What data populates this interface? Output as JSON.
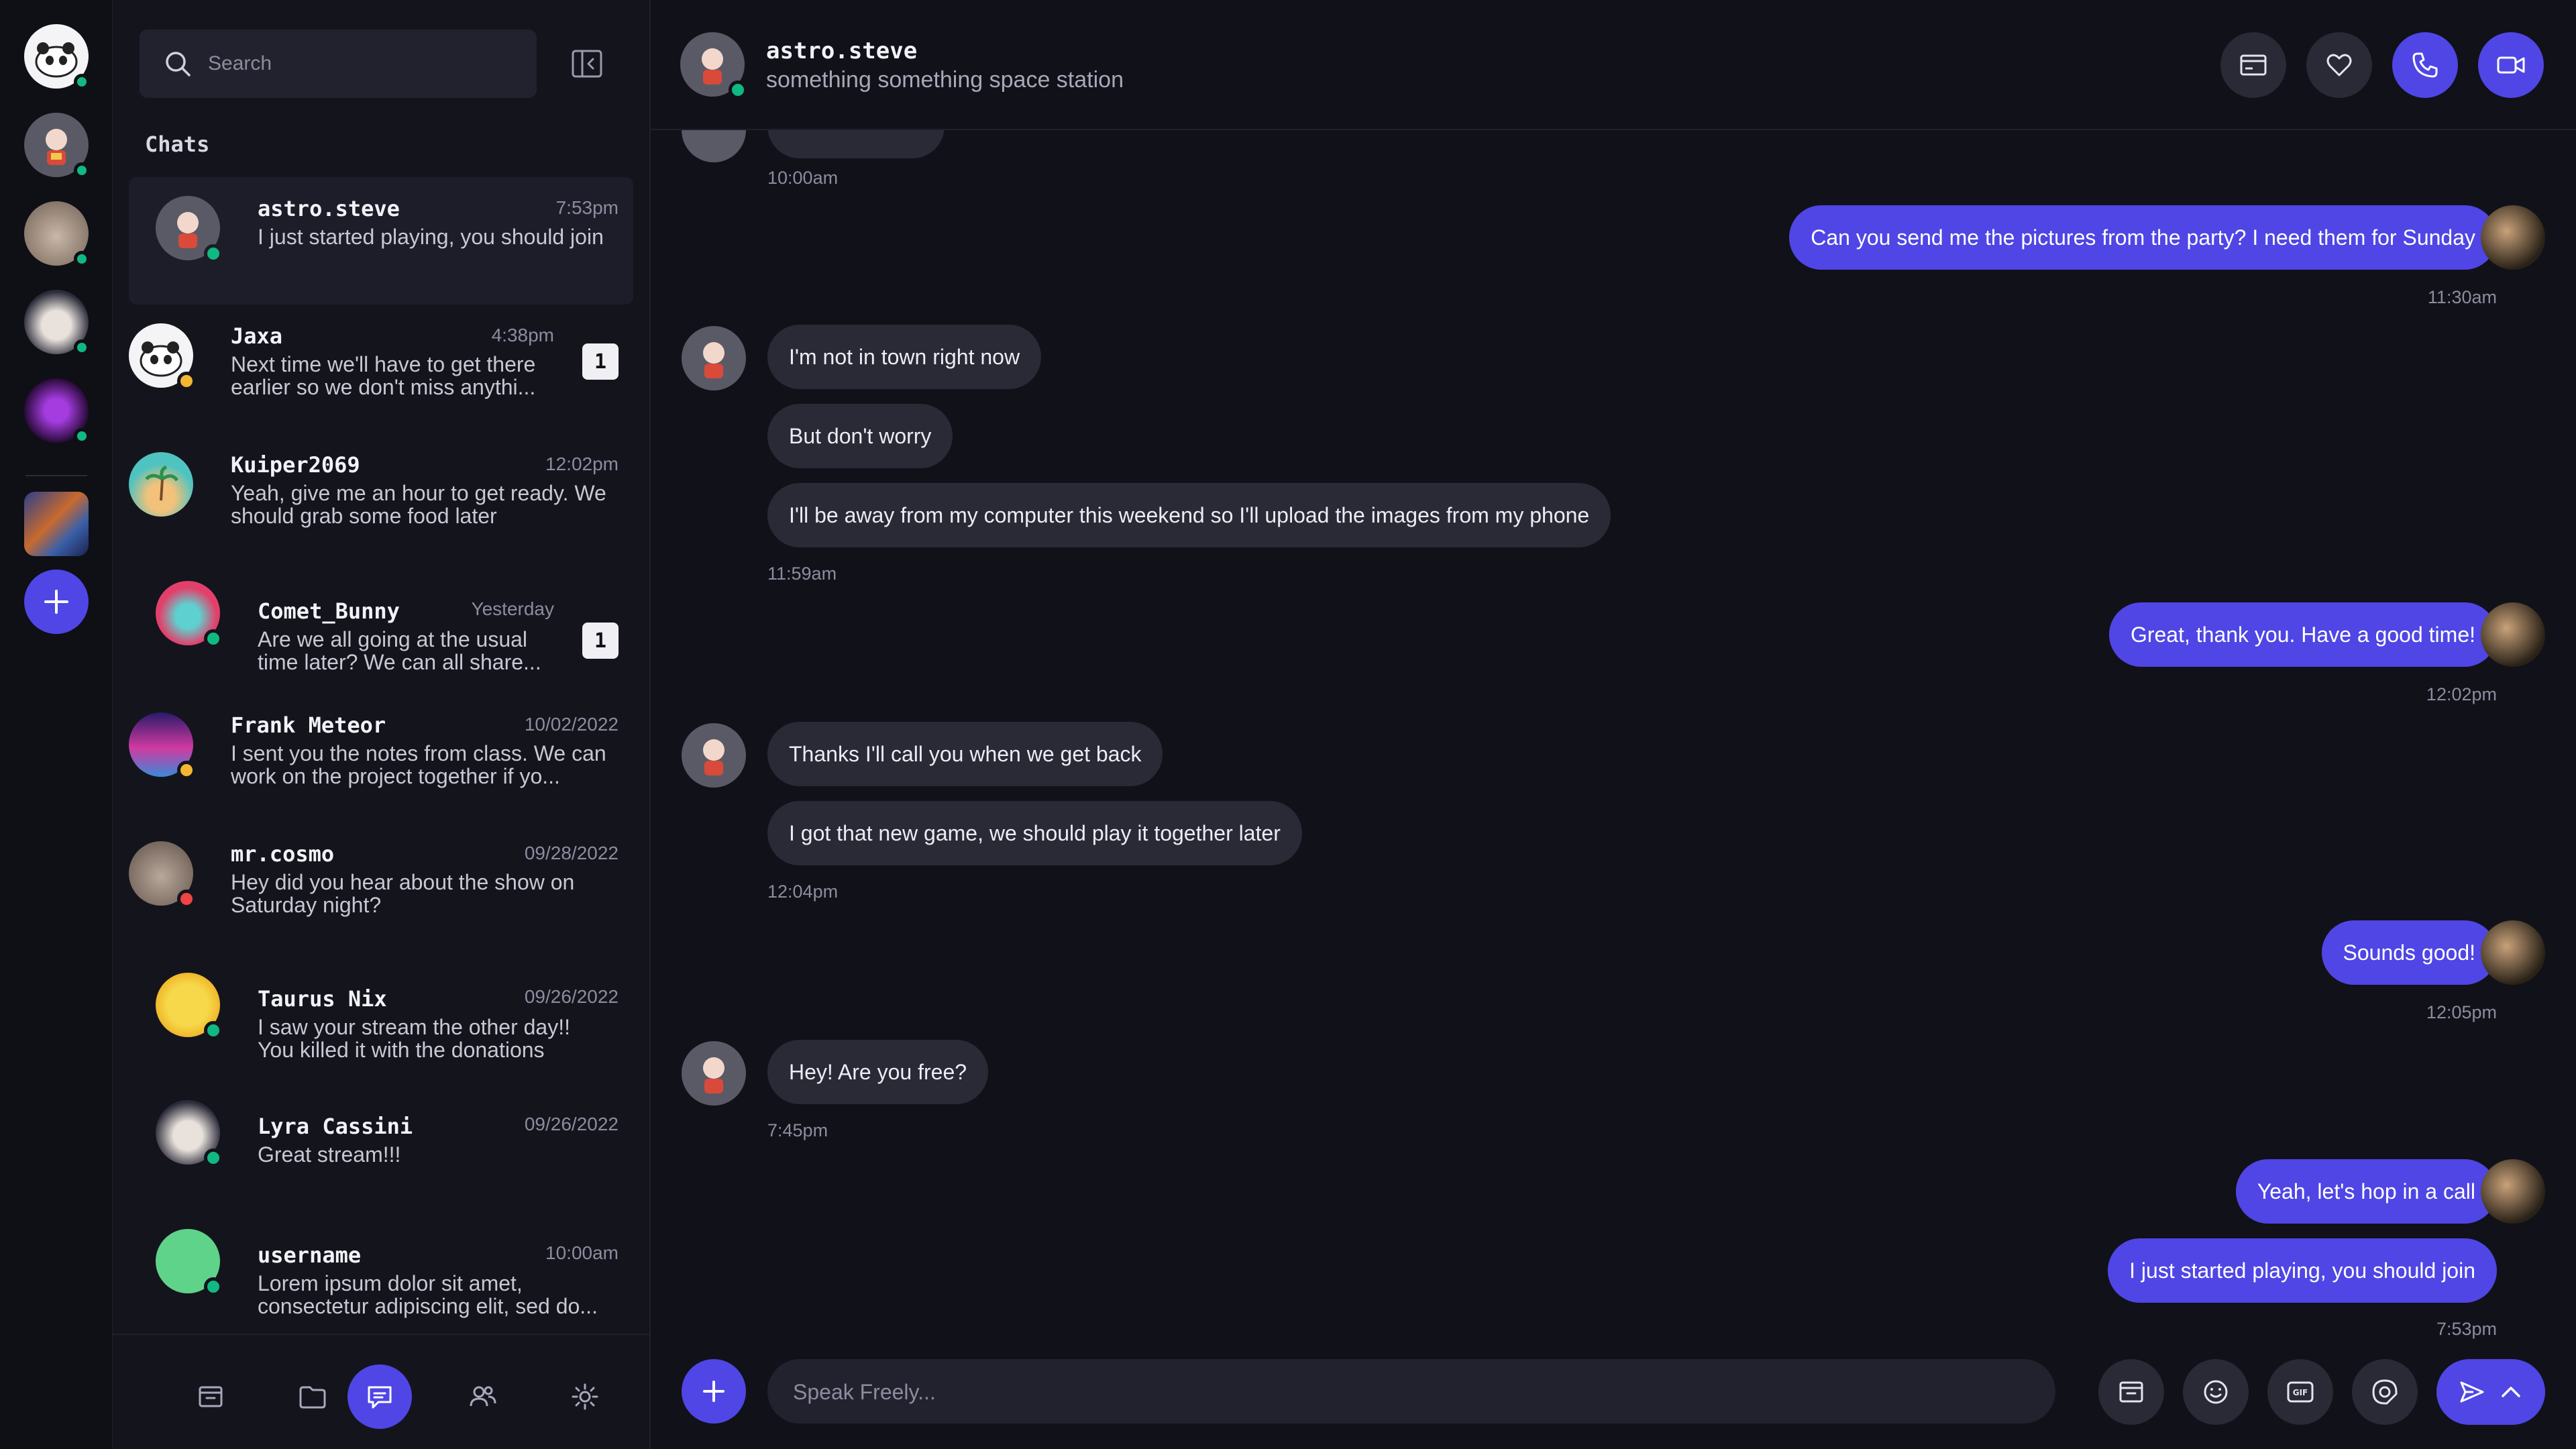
{
  "search": {
    "placeholder": "Search"
  },
  "sidebar": {
    "heading": "Chats",
    "chats": [
      {
        "name": "astro.steve",
        "time": "7:53pm",
        "preview": "I just started playing, you should join",
        "badge": "",
        "status": "online"
      },
      {
        "name": "Jaxa",
        "time": "4:38pm",
        "preview": "Next time we'll have to get there earlier so we don't miss anythi...",
        "badge": "1",
        "status": "away"
      },
      {
        "name": "Kuiper2069",
        "time": "12:02pm",
        "preview": "Yeah, give me an hour to get ready. We should grab some food later",
        "badge": "",
        "status": "none"
      },
      {
        "name": "Comet_Bunny",
        "time": "Yesterday",
        "preview": "Are we all going at the usual time later? We can all share...",
        "badge": "1",
        "status": "online"
      },
      {
        "name": "Frank Meteor",
        "time": "10/02/2022",
        "preview": "I sent you the notes from class. We can work on the project together if yo...",
        "badge": "",
        "status": "away"
      },
      {
        "name": "mr.cosmo",
        "time": "09/28/2022",
        "preview": "Hey did you hear about the show on Saturday night?",
        "badge": "",
        "status": "busy"
      },
      {
        "name": "Taurus Nix",
        "time": "09/26/2022",
        "preview": "I saw your stream the other day!! You killed it with the donations",
        "badge": "",
        "status": "online"
      },
      {
        "name": "Lyra Cassini",
        "time": "09/26/2022",
        "preview": "Great stream!!!",
        "badge": "",
        "status": "online"
      },
      {
        "name": "username",
        "time": "10:00am",
        "preview": "Lorem ipsum dolor sit amet, consectetur adipiscing elit, sed do...",
        "badge": "",
        "status": "online"
      }
    ]
  },
  "header": {
    "name": "astro.steve",
    "status_text": "something something space station"
  },
  "messages": {
    "t1": "10:00am",
    "m1": "Can you send me the pictures from the party? I need them for Sunday",
    "t2": "11:30am",
    "m2": "I'm not in town right now",
    "m3": "But don't worry",
    "m4": "I'll be away from my computer this weekend so I'll upload the images from my phone",
    "t3": "11:59am",
    "m5": "Great, thank you. Have a good time!",
    "t4": "12:02pm",
    "m6": "Thanks I'll call you when we get back",
    "m7": "I got that new game, we should play it together later",
    "t5": "12:04pm",
    "m8": "Sounds good!",
    "t6": "12:05pm",
    "m9": "Hey! Are you free?",
    "t7": "7:45pm",
    "m10": "Yeah, let's hop in a call",
    "m11": "I just started playing, you should join",
    "t8": "7:53pm"
  },
  "composer": {
    "placeholder": "Speak Freely..."
  },
  "colors": {
    "accent": "#4f46e5",
    "online": "#10b981",
    "away": "#f5b731",
    "busy": "#ef4444"
  }
}
